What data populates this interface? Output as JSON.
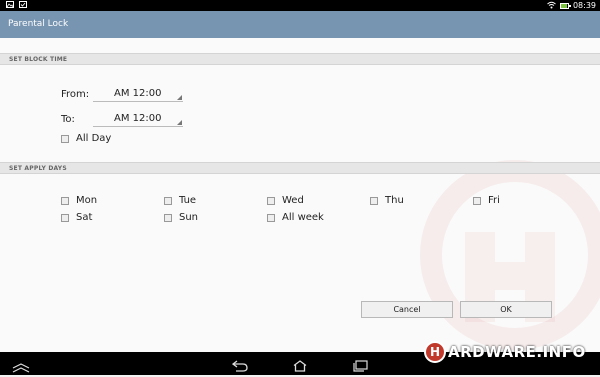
{
  "status_bar": {
    "time": "08:39",
    "battery_level": 0.85
  },
  "title_bar": {
    "title": "Parental Lock"
  },
  "block_time": {
    "header": "SET BLOCK TIME",
    "from_label": "From:",
    "from_value": "AM 12:00",
    "to_label": "To:",
    "to_value": "AM 12:00",
    "all_day_label": "All Day",
    "all_day_checked": false
  },
  "apply_days": {
    "header": "SET APPLY DAYS",
    "days": [
      {
        "label": "Mon",
        "checked": false
      },
      {
        "label": "Tue",
        "checked": false
      },
      {
        "label": "Wed",
        "checked": false
      },
      {
        "label": "Thu",
        "checked": false
      },
      {
        "label": "Fri",
        "checked": false
      },
      {
        "label": "Sat",
        "checked": false
      },
      {
        "label": "Sun",
        "checked": false
      },
      {
        "label": "All week",
        "checked": false
      }
    ]
  },
  "buttons": {
    "cancel_label": "Cancel",
    "ok_label": "OK"
  },
  "nav_icons": [
    "up-chevron-icon",
    "back-icon",
    "home-icon",
    "recent-apps-icon"
  ],
  "watermark": {
    "brand_logo_letter": "H",
    "brand_text": "ARDWARE.INFO"
  },
  "colors": {
    "title_bar": "#7794b1",
    "status_bar": "#000000",
    "nav_bar": "#000000",
    "brand": "#c0392b"
  }
}
